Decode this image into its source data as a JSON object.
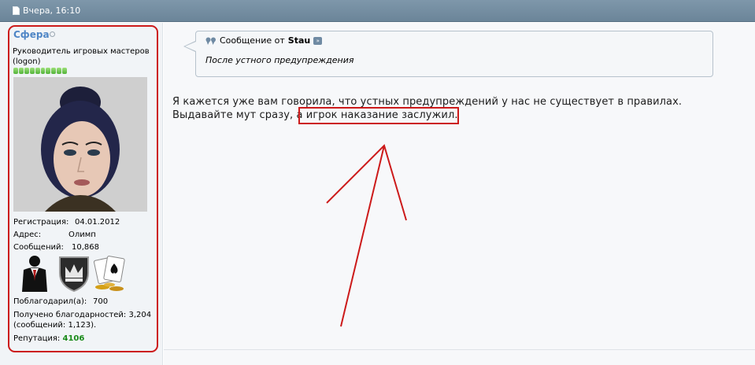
{
  "post_header": {
    "date": "Вчера, 16:10",
    "doc_icon": "post-document-icon"
  },
  "user": {
    "name": "Сфера",
    "status_icon": "offline-icon",
    "title": "Руководитель игровых мастеров (logon)",
    "reputation_segments": 10,
    "registration_label": "Регистрация:",
    "registration_value": "04.01.2012",
    "address_label": "Адрес:",
    "address_value": "Олимп",
    "messages_label": "Сообщений:",
    "messages_value": "10,868",
    "awards": [
      "suit-award-icon",
      "crown-shield-award-icon",
      "poker-cards-award-icon"
    ],
    "thanked_label": "Поблагодарил(а):",
    "thanked_value": "700",
    "received_thanks": "Получено благодарностей: 3,204 (сообщений: 1,123).",
    "reputation_label": "Репутация:",
    "reputation_value": "4106"
  },
  "quote": {
    "prefix": "Сообщение от",
    "author": "Stau",
    "quote_icon": "quote-marks-icon",
    "view_icon": "view-post-icon",
    "text": "После устного предупреждения"
  },
  "post": {
    "line1": "Я кажется уже вам говорила, что устных предупреждений у нас не существует в правилах.",
    "line2_start": "Выдавайте мут сразу, а ",
    "line2_highlight": "игрок наказание заслужил."
  },
  "colors": {
    "header_bg": "#7e97aa",
    "annotation_red": "#cc1a1a",
    "username": "#4f86c6",
    "reputation_green": "#1a8a1a"
  }
}
